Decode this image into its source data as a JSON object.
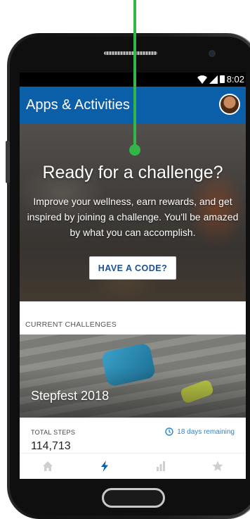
{
  "status_bar": {
    "time": "8:02",
    "icons": [
      "wifi-icon",
      "signal-icon",
      "battery-icon"
    ]
  },
  "app_bar": {
    "title": "Apps & Activities",
    "avatar": "avatar"
  },
  "hero": {
    "title": "Ready for a challenge?",
    "text": "Improve your wellness, earn rewards, and get inspired by joining a challenge. You'll be amazed by what you can accomplish.",
    "button_label": "HAVE A CODE?"
  },
  "current_challenges": {
    "section_label": "CURRENT CHALLENGES",
    "items": [
      {
        "name": "Stepfest 2018",
        "metric_label": "TOTAL STEPS",
        "metric_value": "114,713",
        "remaining": "18 days remaining"
      }
    ]
  },
  "bottom_nav": {
    "items": [
      {
        "icon": "home-icon",
        "active": false
      },
      {
        "icon": "lightning-icon",
        "active": true
      },
      {
        "icon": "bar-chart-icon",
        "active": false
      },
      {
        "icon": "star-icon",
        "active": false
      }
    ]
  },
  "colors": {
    "app_bar": "#0b5ea8",
    "accent": "#2a86d1",
    "button_text": "#1d4f91",
    "annotation": "#33b54a",
    "inactive_icon": "#cfcfcf"
  }
}
